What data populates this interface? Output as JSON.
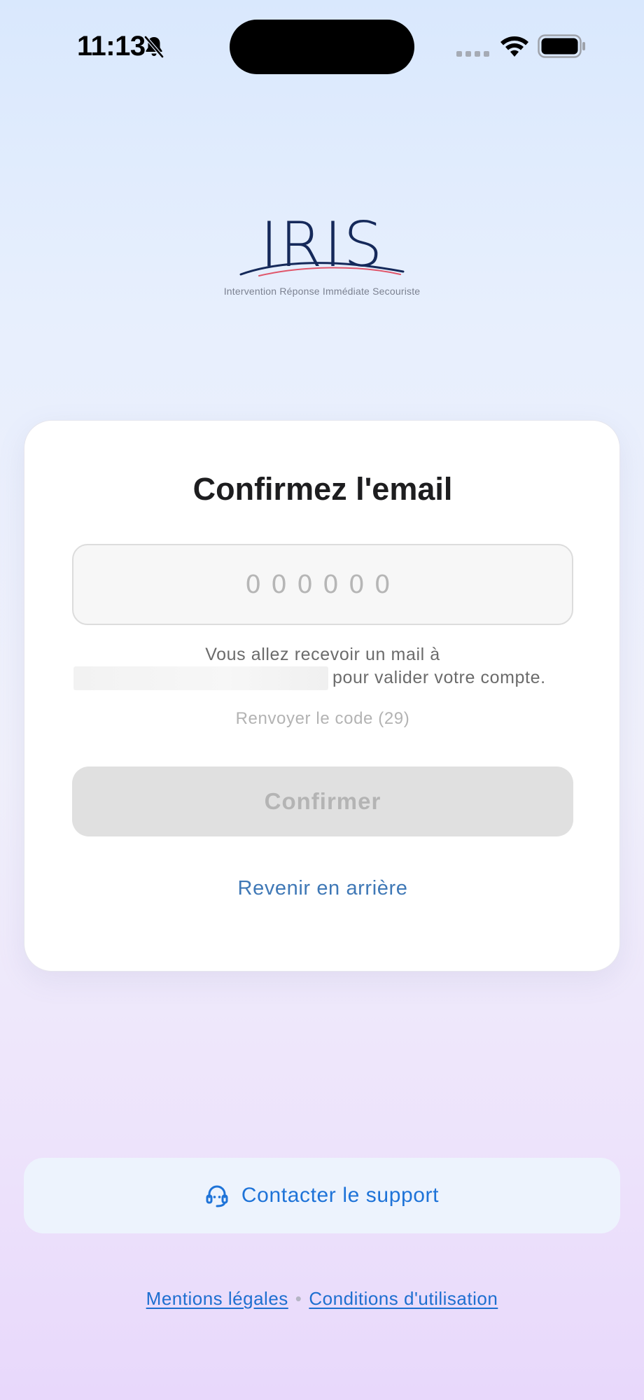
{
  "status_bar": {
    "time": "11:13",
    "icons": [
      "bell-slash-icon",
      "signal-icon",
      "wifi-icon",
      "battery-icon"
    ]
  },
  "logo": {
    "name": "IRIS",
    "tagline": "Intervention Réponse Immédiate Secouriste"
  },
  "card": {
    "title": "Confirmez l'email",
    "code_input": {
      "value": "",
      "placeholder": "000000"
    },
    "info_line_1": "Vous allez recevoir un mail à",
    "info_line_2": "pour valider votre compte.",
    "resend_label": "Renvoyer le code (29)",
    "confirm_label": "Confirmer",
    "back_label": "Revenir en arrière"
  },
  "support": {
    "label": "Contacter le support",
    "icon": "headset-icon"
  },
  "footer": {
    "legal_label": "Mentions légales",
    "separator": "•",
    "terms_label": "Conditions d'utilisation"
  },
  "colors": {
    "accent": "#1e73d8",
    "link": "#3f78b6",
    "brand_navy": "#15295a",
    "disabled_bg": "#e0e0e0",
    "disabled_text": "#b4b4b4"
  }
}
